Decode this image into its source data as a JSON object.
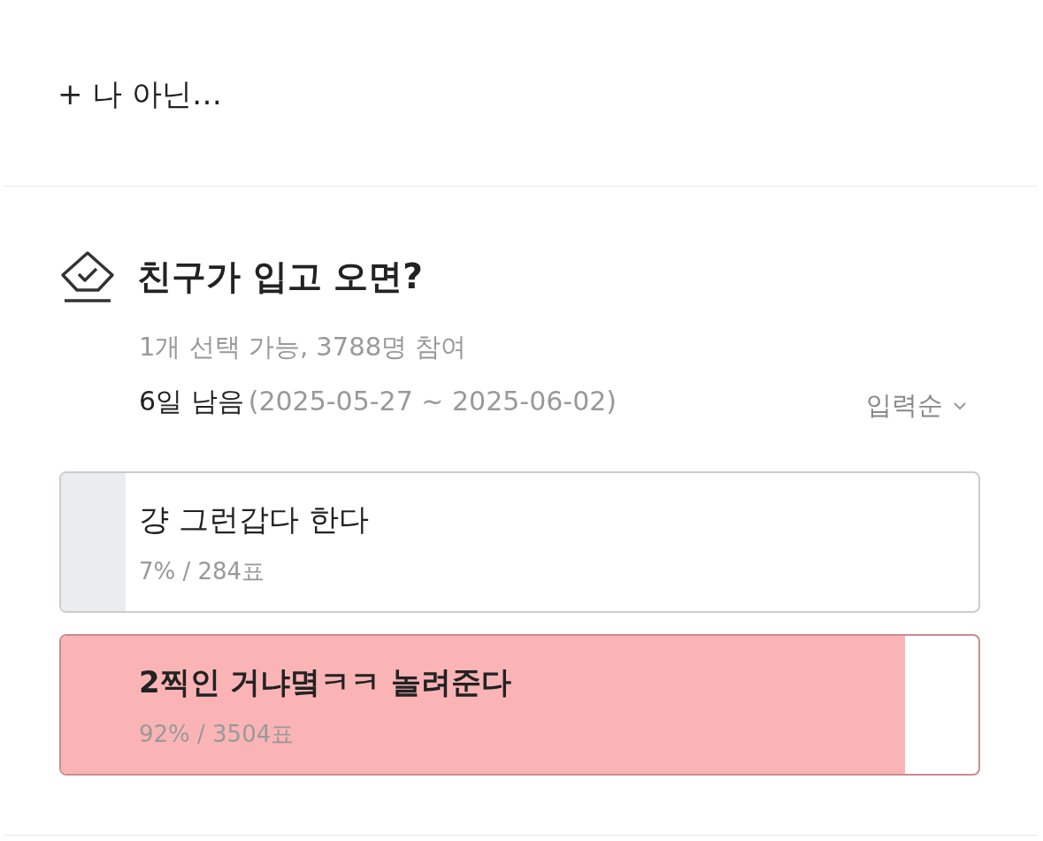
{
  "add_option": {
    "label": "+ 나 아닌…"
  },
  "poll": {
    "title": "친구가 입고 오면?",
    "info": "1개 선택 가능, 3788명 참여",
    "remaining": "6일 남음",
    "period": "(2025-05-27 ~ 2025-06-02)",
    "sort": "입력순",
    "options": [
      {
        "label": "걍 그런갑다 한다",
        "result": "7% / 284표",
        "level": 0.07,
        "selected": false
      },
      {
        "label": "2찍인 거냐몈ㅋㅋ 놀려준다",
        "result": "92% / 3504표",
        "level": 0.92,
        "selected": true
      }
    ]
  }
}
